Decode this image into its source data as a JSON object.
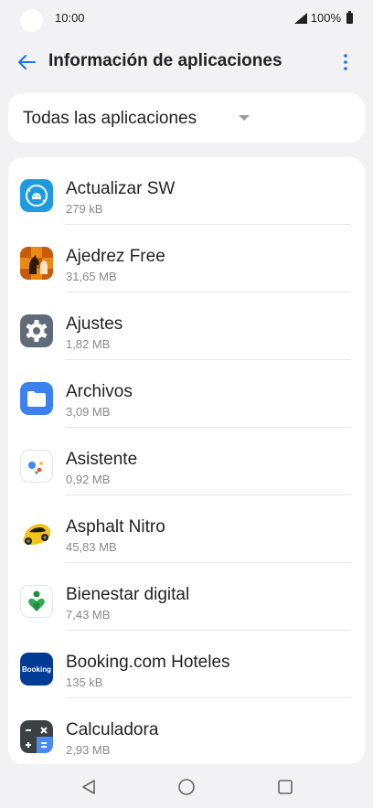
{
  "status_bar": {
    "time": "10:00",
    "battery_text": "100%"
  },
  "app_bar": {
    "title": "Información de aplicaciones",
    "back_icon": "arrow-left-icon",
    "more_icon": "more-vert-icon",
    "accent_color": "#1a73e8"
  },
  "filter": {
    "label": "Todas las aplicaciones"
  },
  "apps": [
    {
      "name": "Actualizar SW",
      "size": "279 kB",
      "icon": "software-update-icon"
    },
    {
      "name": "Ajedrez Free",
      "size": "31,65 MB",
      "icon": "chess-icon"
    },
    {
      "name": "Ajustes",
      "size": "1,82 MB",
      "icon": "settings-gear-icon"
    },
    {
      "name": "Archivos",
      "size": "3,09 MB",
      "icon": "folder-icon"
    },
    {
      "name": "Asistente",
      "size": "0,92 MB",
      "icon": "assistant-icon"
    },
    {
      "name": "Asphalt Nitro",
      "size": "45,83 MB",
      "icon": "race-car-icon"
    },
    {
      "name": "Bienestar digital",
      "size": "7,43 MB",
      "icon": "digital-wellbeing-icon"
    },
    {
      "name": "Booking.com Hoteles",
      "size": "135 kB",
      "icon": "booking-icon",
      "icon_text": "Booking"
    },
    {
      "name": "Calculadora",
      "size": "2,93 MB",
      "icon": "calculator-icon"
    }
  ]
}
